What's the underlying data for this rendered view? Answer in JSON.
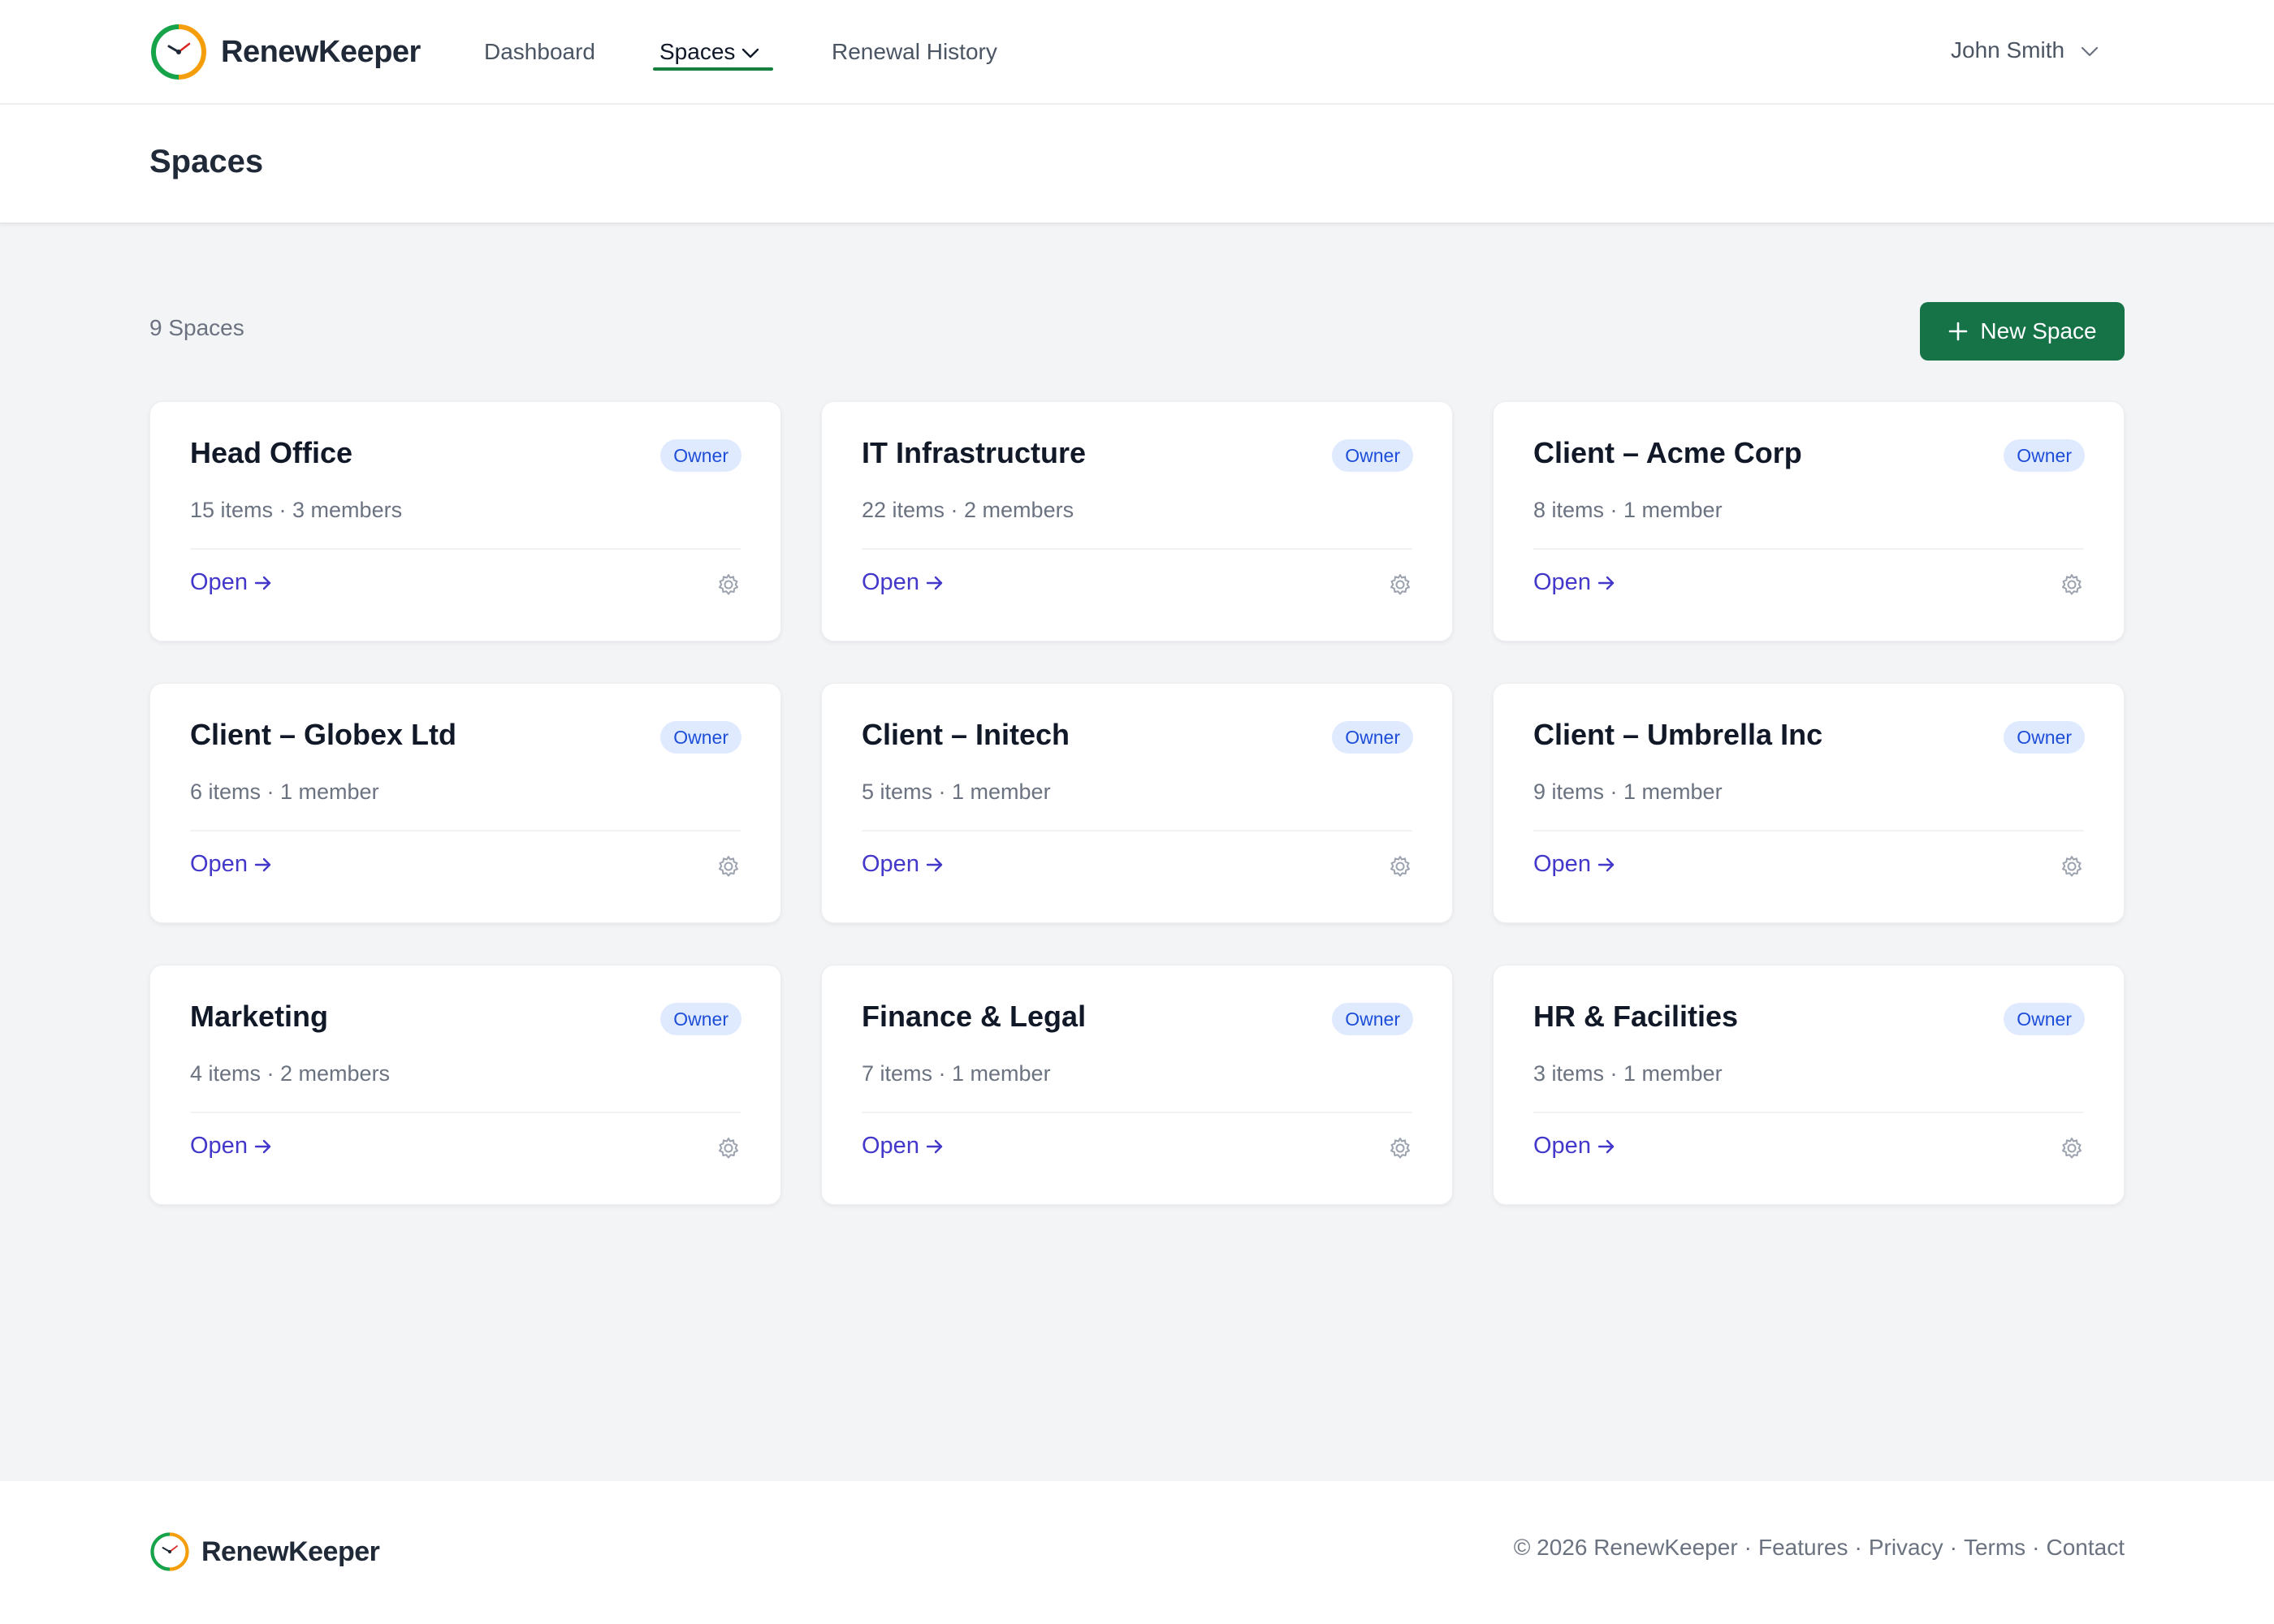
{
  "app": {
    "name": "RenewKeeper",
    "accent_color": "#157347",
    "link_color": "#4338ca",
    "logo_icon": "clock-icon"
  },
  "nav": {
    "items": [
      {
        "label": "Dashboard",
        "active": false
      },
      {
        "label": "Spaces",
        "active": true,
        "has_dropdown": true
      },
      {
        "label": "Renewal History",
        "active": false
      }
    ],
    "user_name": "John Smith"
  },
  "page": {
    "title": "Spaces",
    "count_label": "9 Spaces",
    "new_button_label": "New Space"
  },
  "spaces": [
    {
      "name": "Head Office",
      "role": "Owner",
      "meta": "15 items · 3 members",
      "open_label": "Open"
    },
    {
      "name": "IT Infrastructure",
      "role": "Owner",
      "meta": "22 items · 2 members",
      "open_label": "Open"
    },
    {
      "name": "Client – Acme Corp",
      "role": "Owner",
      "meta": "8 items · 1 member",
      "open_label": "Open"
    },
    {
      "name": "Client – Globex Ltd",
      "role": "Owner",
      "meta": "6 items · 1 member",
      "open_label": "Open"
    },
    {
      "name": "Client – Initech",
      "role": "Owner",
      "meta": "5 items · 1 member",
      "open_label": "Open"
    },
    {
      "name": "Client – Umbrella Inc",
      "role": "Owner",
      "meta": "9 items · 1 member",
      "open_label": "Open"
    },
    {
      "name": "Marketing",
      "role": "Owner",
      "meta": "4 items · 2 members",
      "open_label": "Open"
    },
    {
      "name": "Finance & Legal",
      "role": "Owner",
      "meta": "7 items · 1 member",
      "open_label": "Open"
    },
    {
      "name": "HR & Facilities",
      "role": "Owner",
      "meta": "3 items · 1 member",
      "open_label": "Open"
    }
  ],
  "footer": {
    "brand": "RenewKeeper",
    "copyright": "© 2026 RenewKeeper",
    "links": [
      "Features",
      "Privacy",
      "Terms",
      "Contact"
    ]
  }
}
